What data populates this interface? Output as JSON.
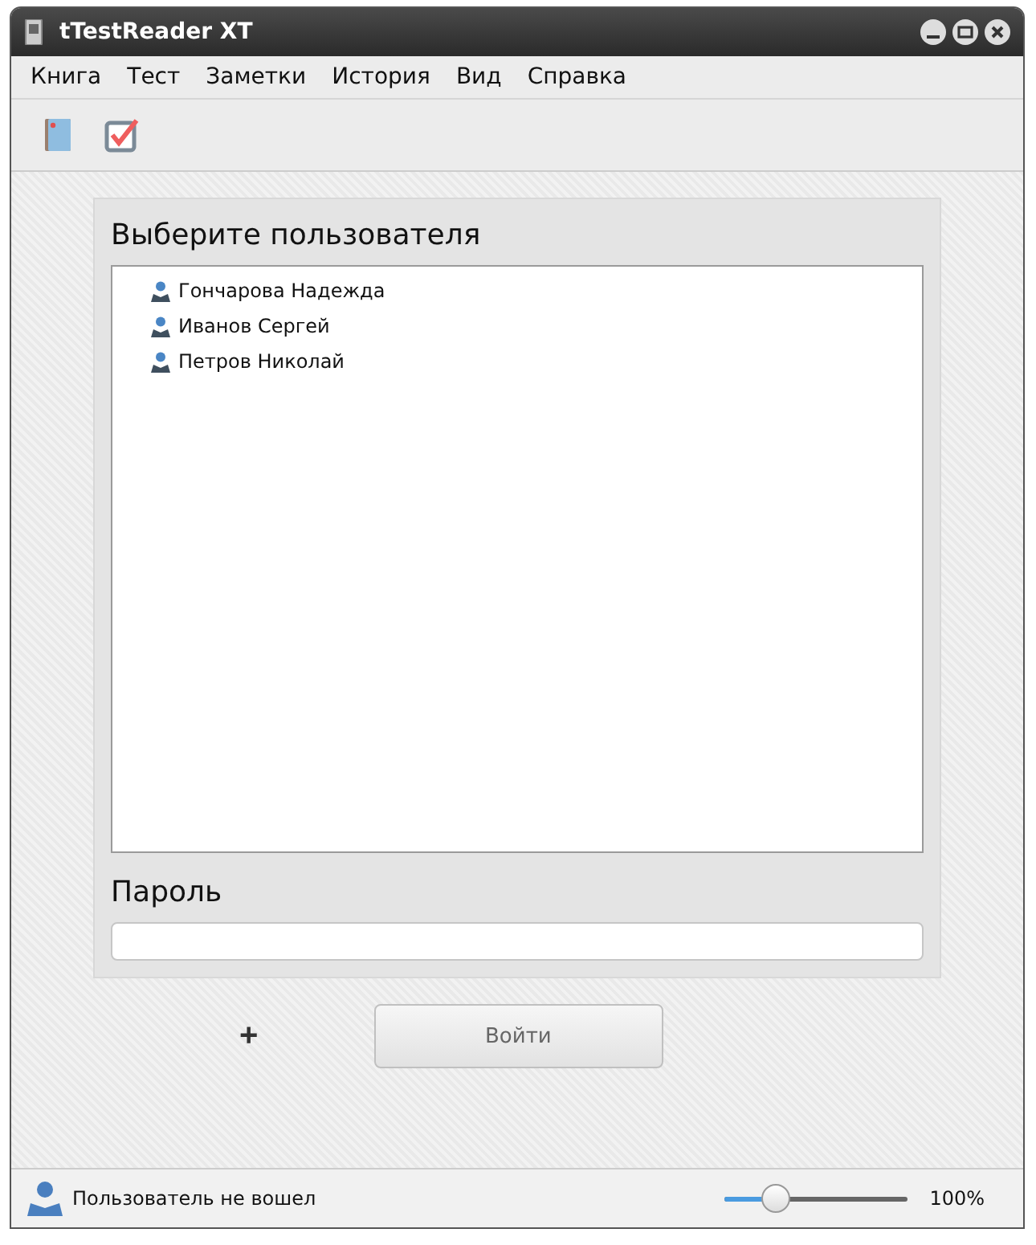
{
  "window": {
    "title": "tTestReader XT"
  },
  "menu": [
    "Книга",
    "Тест",
    "Заметки",
    "История",
    "Вид",
    "Справка"
  ],
  "users_panel": {
    "title": "Выберите пользователя",
    "users": [
      {
        "name": "Гончарова Надежда",
        "selected": false
      },
      {
        "name": "Иванов Сергей",
        "selected": false
      },
      {
        "name": "Петров Николай",
        "selected": false
      }
    ],
    "password_label": "Пароль"
  },
  "add_button": "+",
  "login_button": "Войти",
  "status_bar": {
    "user_status": "Пользователь не вошел",
    "zoom": {
      "level": 0.28
    },
    "zoom_reading": "100%"
  }
}
